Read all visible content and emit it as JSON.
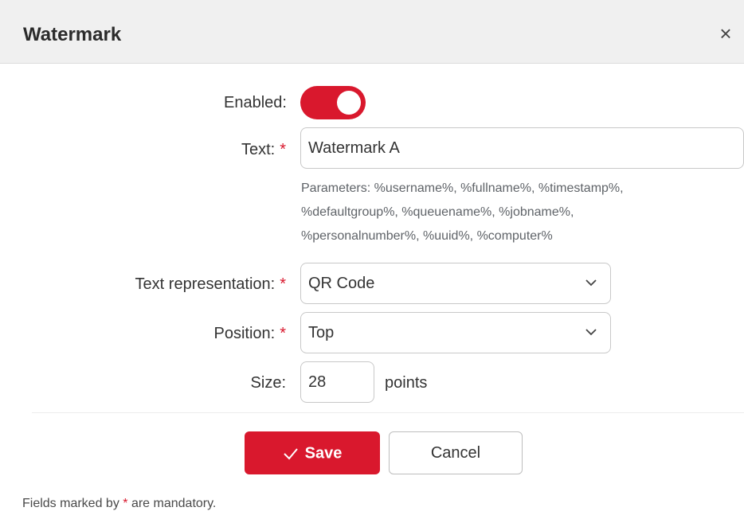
{
  "dialog": {
    "title": "Watermark",
    "close_glyph": "×"
  },
  "form": {
    "enabled": {
      "label": "Enabled:",
      "value": true
    },
    "text": {
      "label": "Text:",
      "value": "Watermark A"
    },
    "help_lines": [
      "Parameters: %username%, %fullname%, %timestamp%,",
      "%defaultgroup%, %queuename%, %jobname%,",
      "%personalnumber%, %uuid%, %computer%"
    ],
    "text_representation": {
      "label": "Text representation:",
      "value": "QR Code"
    },
    "position": {
      "label": "Position:",
      "value": "Top"
    },
    "size": {
      "label": "Size:",
      "value": "28",
      "suffix": "points"
    },
    "required_mark": "*"
  },
  "actions": {
    "save_label": "Save",
    "cancel_label": "Cancel"
  },
  "footer": {
    "note_before": "Fields marked by ",
    "note_mark": "*",
    "note_after": " are mandatory."
  },
  "colors": {
    "accent": "#d9182d",
    "header_bg": "#f0f0f0"
  },
  "icons": {
    "close": "close-icon",
    "chevron": "chevron-down-icon",
    "check": "check-icon"
  }
}
